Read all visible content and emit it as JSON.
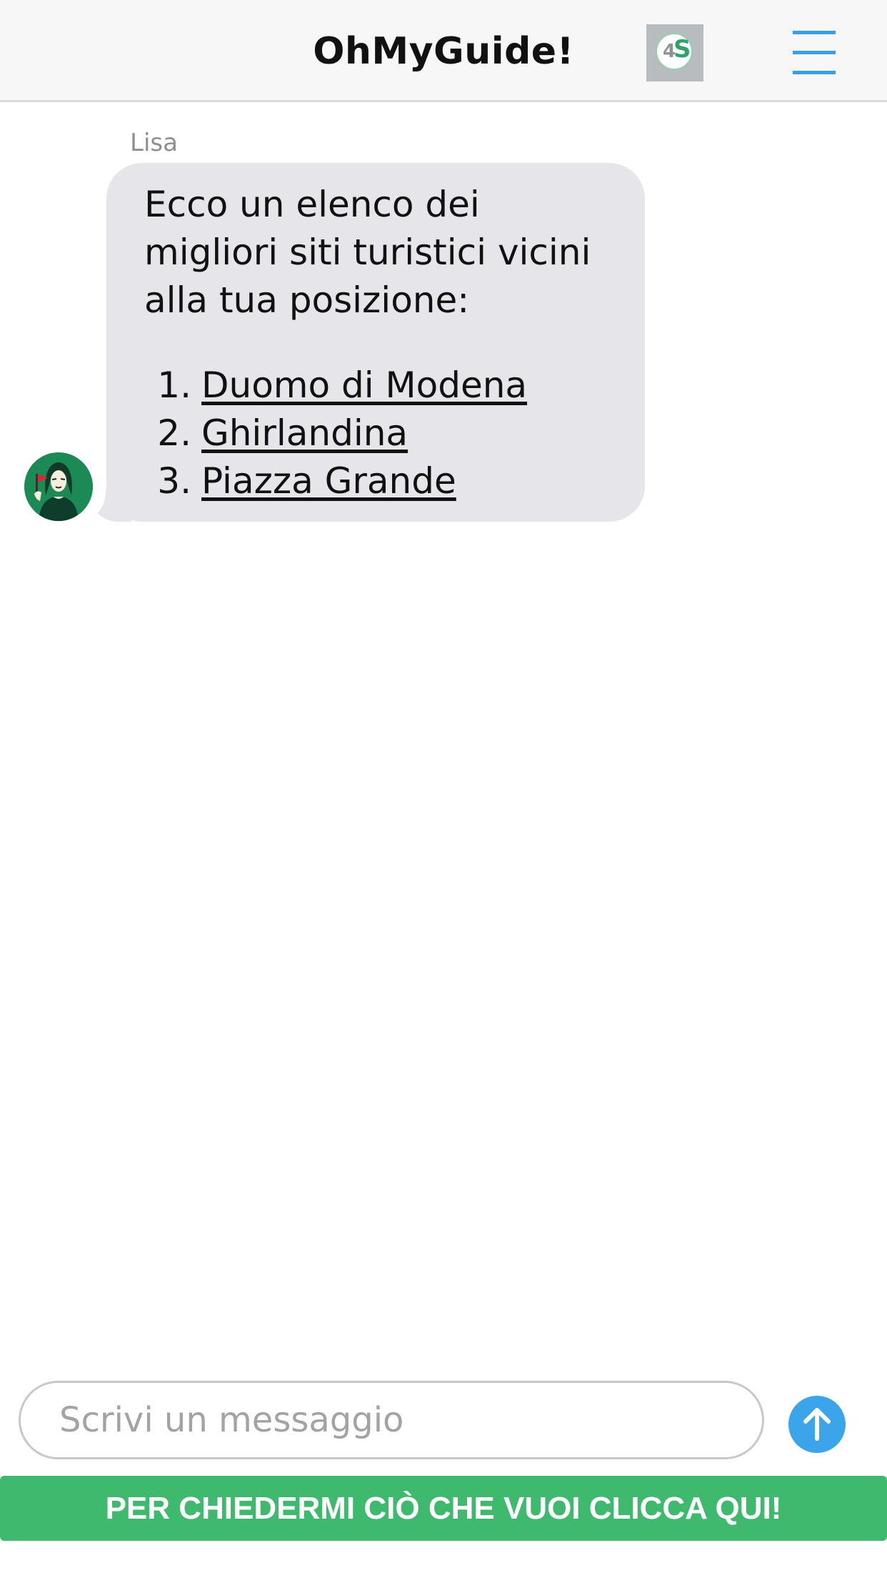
{
  "header": {
    "title": "OhMyGuide!",
    "logo_text_number": "4",
    "logo_text_letter": "S",
    "logo_icon": "4s-logo-icon",
    "menu_icon": "hamburger-menu-icon"
  },
  "conversation": {
    "sender_name": "Lisa",
    "avatar_icon": "mona-lisa-avatar-icon",
    "message": {
      "intro": "Ecco un elenco dei migliori siti turistici vicini alla tua posizione:",
      "items": [
        {
          "number": "1.",
          "label": "Duomo di Modena"
        },
        {
          "number": "2.",
          "label": "Ghirlandina"
        },
        {
          "number": "3.",
          "label": "Piazza Grande"
        }
      ]
    }
  },
  "composer": {
    "placeholder": "Scrivi un messaggio",
    "send_icon": "arrow-up-icon"
  },
  "cta": {
    "label": "PER CHIEDERMI CIÒ CHE VUOI CLICCA QUI!"
  },
  "colors": {
    "accent_blue": "#3aa5ea",
    "cta_green": "#3eb96e",
    "bubble_gray": "#e5e5ea",
    "header_bg": "#f7f7f7"
  }
}
